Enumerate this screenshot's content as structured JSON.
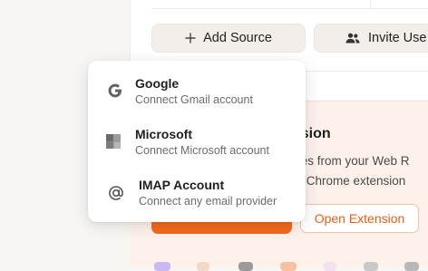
{
  "toolbar": {
    "add_source_label": "Add Source",
    "invite_label": "Invite Use"
  },
  "extension": {
    "title": "nsion",
    "line1": "ices from your Web R",
    "line2": "ur Chrome extension",
    "open_button": "Open Extension",
    "accent_color": "#f26a1b"
  },
  "dropdown": {
    "options": [
      {
        "name": "Google",
        "desc": "Connect Gmail account",
        "icon": "google-icon"
      },
      {
        "name": "Microsoft",
        "desc": "Connect Microsoft account",
        "icon": "microsoft-icon"
      },
      {
        "name": "IMAP Account",
        "desc": "Connect any email provider",
        "icon": "at-sign-icon"
      }
    ]
  }
}
